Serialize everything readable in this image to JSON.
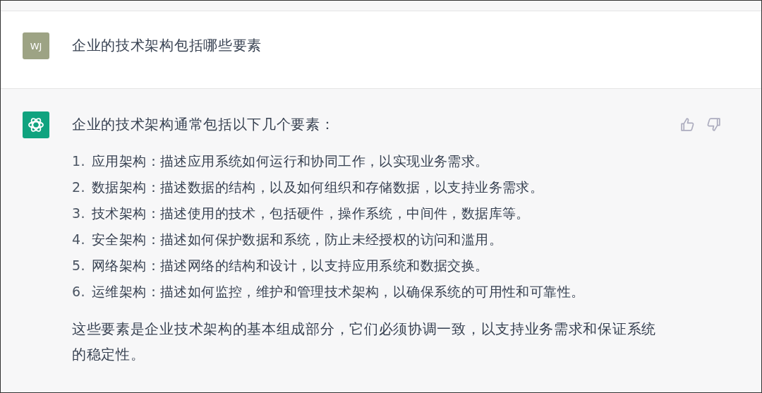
{
  "conversation": [
    {
      "kind": "user",
      "avatar": "WJ",
      "text": "企业的技术架构包括哪些要素"
    },
    {
      "kind": "assistant",
      "intro": "企业的技术架构通常包括以下几个要素：",
      "items": [
        {
          "number": "1.",
          "text": "应用架构：描述应用系统如何运行和协同工作，以实现业务需求。"
        },
        {
          "number": "2.",
          "text": "数据架构：描述数据的结构，以及如何组织和存储数据，以支持业务需求。"
        },
        {
          "number": "3.",
          "text": "技术架构：描述使用的技术，包括硬件，操作系统，中间件，数据库等。"
        },
        {
          "number": "4.",
          "text": "安全架构：描述如何保护数据和系统，防止未经授权的访问和滥用。"
        },
        {
          "number": "5.",
          "text": "网络架构：描述网络的结构和设计，以支持应用系统和数据交换。"
        },
        {
          "number": "6.",
          "text": "运维架构：描述如何监控，维护和管理技术架构，以确保系统的可用性和可靠性。"
        }
      ],
      "conclusion": "这些要素是企业技术架构的基本组成部分，它们必须协调一致，以支持业务需求和保证系统的稳定性。"
    }
  ]
}
